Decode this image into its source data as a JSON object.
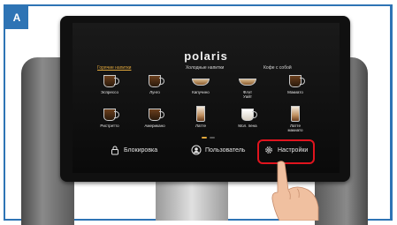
{
  "figure_label": "A",
  "screen": {
    "brand": "polaris",
    "categories": [
      {
        "label": "Горячие напитки",
        "active": true
      },
      {
        "label": "Холодные напитки",
        "active": false
      },
      {
        "label": "Кофе с собой",
        "active": false
      }
    ],
    "drinks": [
      {
        "label": "Эспрессо",
        "icon": "espresso-cup-icon"
      },
      {
        "label": "Лунго",
        "icon": "lungo-cup-icon"
      },
      {
        "label": "Капучино",
        "icon": "cappuccino-cup-icon"
      },
      {
        "label": "Флэт Уайт",
        "icon": "flat-white-cup-icon"
      },
      {
        "label": "Макиато",
        "icon": "macchiato-cup-icon"
      },
      {
        "label": "Ристретто",
        "icon": "ristretto-cup-icon"
      },
      {
        "label": "Американо",
        "icon": "americano-cup-icon"
      },
      {
        "label": "Латте",
        "icon": "latte-glass-icon"
      },
      {
        "label": "Мол. пена",
        "icon": "milk-foam-cup-icon"
      },
      {
        "label": "Латте макиато",
        "icon": "latte-macchiato-glass-icon"
      }
    ],
    "bottom": {
      "lock_label": "Блокировка",
      "user_label": "Пользователь",
      "settings_label": "Настройки"
    }
  },
  "colors": {
    "frame": "#2e74b5",
    "highlight": "#e0141e",
    "active_category": "#e2a83c"
  }
}
